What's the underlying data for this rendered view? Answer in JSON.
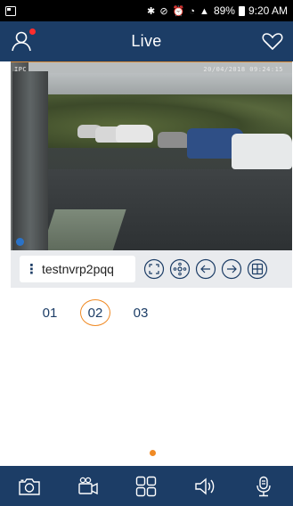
{
  "status_bar": {
    "battery": "89%",
    "time": "9:20 AM",
    "icons": [
      "bluetooth-icon",
      "mute-icon",
      "alarm-icon",
      "wifi-icon",
      "signal-icon",
      "battery-icon"
    ]
  },
  "header": {
    "title": "Live",
    "left_icon": "user-icon",
    "right_icon": "heart-icon",
    "notification_color": "#ff2d2d",
    "background": "#1c3d66"
  },
  "video": {
    "osd_left": "IPC",
    "osd_right": "20/04/2018 09:24:15"
  },
  "toolbar": {
    "device_name": "testnvrp2pqq",
    "icons": [
      "fullscreen-icon",
      "ptz-icon",
      "previous-icon",
      "next-icon",
      "grid-layout-icon"
    ]
  },
  "channels": {
    "items": [
      {
        "label": "01",
        "active": false
      },
      {
        "label": "02",
        "active": true
      },
      {
        "label": "03",
        "active": false
      }
    ],
    "accent_color": "#f08a24"
  },
  "bottom_bar": {
    "icons": [
      "snapshot-icon",
      "record-icon",
      "multi-view-icon",
      "audio-icon",
      "talk-icon"
    ]
  }
}
